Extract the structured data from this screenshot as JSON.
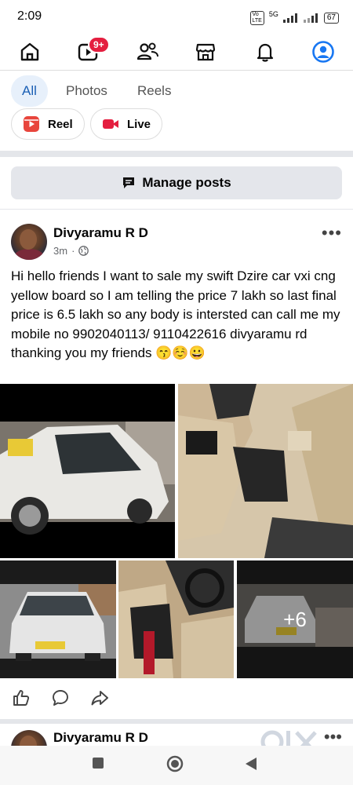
{
  "status_bar": {
    "time": "2:09",
    "network": "5G",
    "battery": "67"
  },
  "nav": {
    "notification_badge": "9+",
    "icons": [
      "home-icon",
      "video-icon",
      "friends-icon",
      "marketplace-icon",
      "bell-icon",
      "profile-icon"
    ]
  },
  "filter_tabs": [
    {
      "label": "All",
      "active": true
    },
    {
      "label": "Photos",
      "active": false
    },
    {
      "label": "Reels",
      "active": false
    }
  ],
  "create_chips": [
    {
      "label": "Reel",
      "icon": "reel-icon"
    },
    {
      "label": "Live",
      "icon": "live-icon"
    }
  ],
  "manage_posts": {
    "label": "Manage posts"
  },
  "post": {
    "author": "Divyaramu R D",
    "time": "3m",
    "text": "Hi hello friends I want to sale my swift Dzire car vxi cng yellow board so I am telling the price 7 lakh so last final price is 6.5 lakh so any body is intersted can call me my mobile no 9902040113/ 9110422616 divyaramu rd  thanking you my friends 😙☺️😀",
    "photos_more": "+6"
  },
  "next_post": {
    "author": "Divyaramu R D"
  },
  "colors": {
    "accent": "#1877f2",
    "badge": "#e41e3f",
    "tab_active_bg": "#e7f0fb"
  }
}
